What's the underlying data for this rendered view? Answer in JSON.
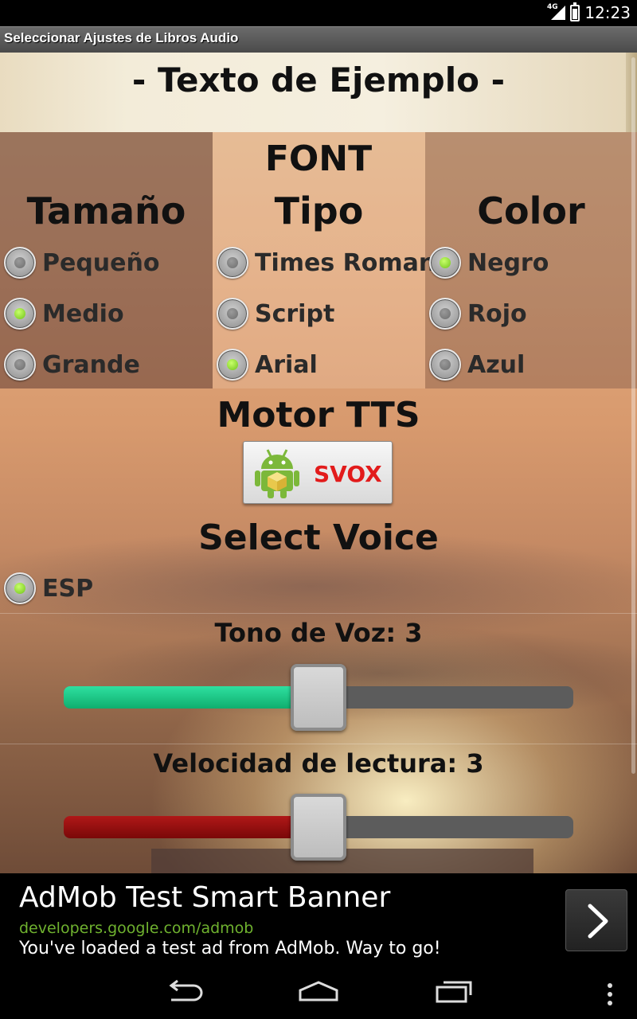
{
  "status_bar": {
    "network_label": "4G",
    "time": "12:23",
    "icons": [
      "signal-4g-icon",
      "battery-icon"
    ]
  },
  "title_bar": {
    "title": "Seleccionar Ajustes de Libros Audio"
  },
  "header": {
    "sample_text": "- Texto de Ejemplo -"
  },
  "font": {
    "label": "FONT",
    "size": {
      "heading": "Tamaño",
      "options": [
        {
          "label": "Pequeño",
          "selected": false
        },
        {
          "label": "Medio",
          "selected": true
        },
        {
          "label": "Grande",
          "selected": false
        }
      ]
    },
    "type": {
      "heading": "Tipo",
      "options": [
        {
          "label": "Times Roman",
          "selected": false
        },
        {
          "label": "Script",
          "selected": false
        },
        {
          "label": "Arial",
          "selected": true
        }
      ]
    },
    "color": {
      "heading": "Color",
      "options": [
        {
          "label": "Negro",
          "selected": true
        },
        {
          "label": "Rojo",
          "selected": false
        },
        {
          "label": "Azul",
          "selected": false
        }
      ]
    }
  },
  "tts": {
    "heading": "Motor TTS",
    "engine_button_label": "SVOX",
    "engine_icon": "android-package-icon"
  },
  "voice": {
    "heading": "Select Voice",
    "options": [
      {
        "label": "ESP",
        "selected": true
      }
    ]
  },
  "sliders": {
    "pitch": {
      "label": "Tono de Voz: 3",
      "value": 3,
      "fraction": 0.5,
      "color": "#1cc987"
    },
    "speed": {
      "label": "Velocidad de lectura: 3",
      "value": 3,
      "fraction": 0.5,
      "color": "#8b0d0d"
    }
  },
  "ad": {
    "title": "AdMob Test Smart Banner",
    "url": "developers.google.com/admob",
    "description": "You've loaded a test ad from AdMob. Way to go!",
    "arrow_icon": "chevron-right-icon"
  },
  "nav": {
    "icons": [
      "back-icon",
      "home-icon",
      "recent-apps-icon",
      "overflow-menu-icon"
    ]
  }
}
